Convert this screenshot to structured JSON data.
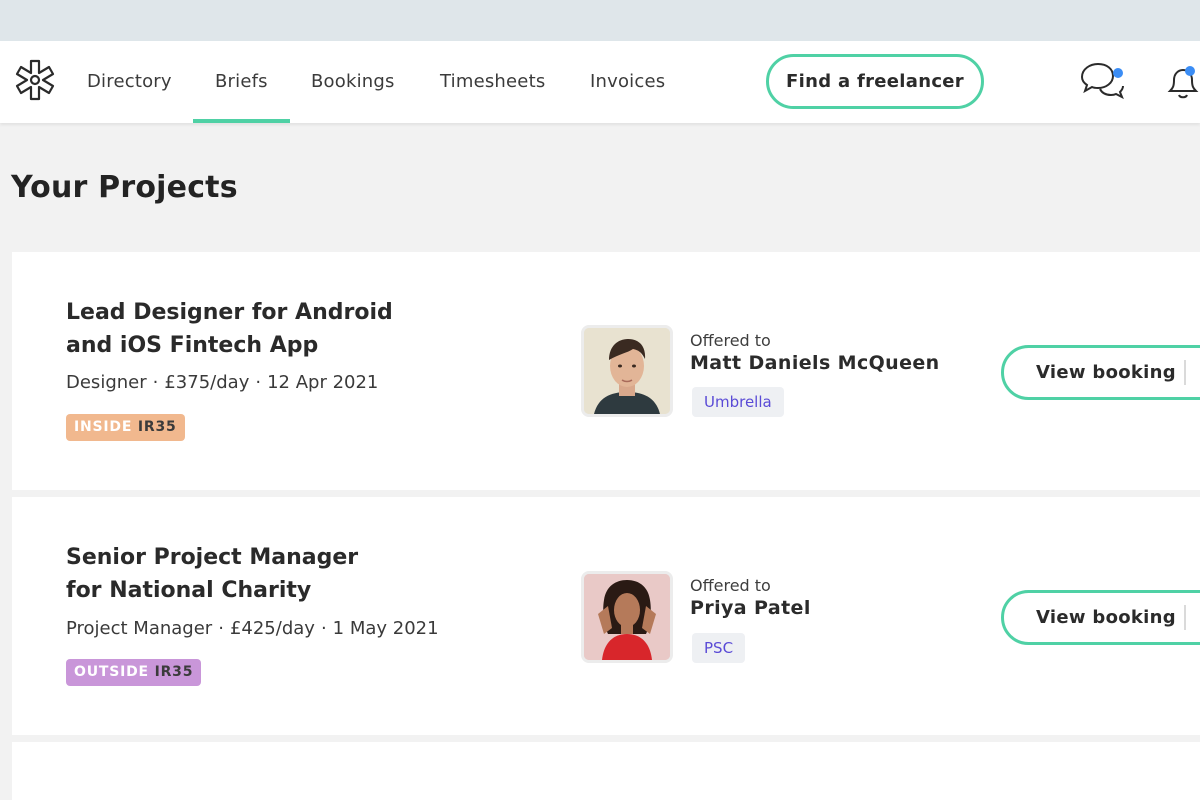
{
  "nav": {
    "items": [
      {
        "label": "Directory",
        "active": false
      },
      {
        "label": "Briefs",
        "active": true
      },
      {
        "label": "Bookings",
        "active": false
      },
      {
        "label": "Timesheets",
        "active": false
      },
      {
        "label": "Invoices",
        "active": false
      }
    ],
    "find_button": "Find a freelancer",
    "icons": [
      "logo-icon",
      "messages-icon",
      "notifications-icon"
    ],
    "accent_color": "#4fd1a5",
    "notification_dot_color": "#3b8df5"
  },
  "page": {
    "title": "Your Projects"
  },
  "projects": [
    {
      "title": "Lead Designer for Android and iOS Fintech App",
      "role": "Designer",
      "rate": "£375/day",
      "date": "12 Apr 2021",
      "ir35_status": "INSIDE",
      "ir35_label": "IR35",
      "ir35_color": "#f1b88e",
      "offered_label": "Offered to",
      "freelancer": "Matt Daniels McQueen",
      "contract_type": "Umbrella",
      "action": "View booking"
    },
    {
      "title": "Senior Project Manager for National Charity",
      "role": "Project Manager",
      "rate": "£425/day",
      "date": "1 May 2021",
      "ir35_status": "OUTSIDE",
      "ir35_label": "IR35",
      "ir35_color": "#c996d9",
      "offered_label": "Offered to",
      "freelancer": "Priya Patel",
      "contract_type": "PSC",
      "action": "View booking"
    }
  ]
}
